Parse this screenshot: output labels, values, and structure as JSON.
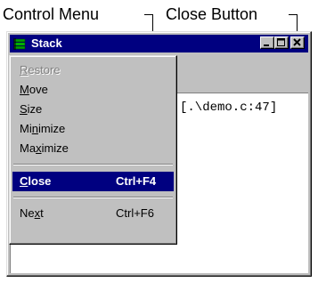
{
  "callouts": {
    "control_menu": "Control Menu",
    "close_button": "Close Button"
  },
  "window": {
    "title": "Stack",
    "content_text": "[.\\demo.c:47]"
  },
  "menu": {
    "items": [
      {
        "label": "Restore",
        "mnemonic": "R",
        "shortcut": "",
        "disabled": true
      },
      {
        "label": "Move",
        "mnemonic": "M",
        "shortcut": "",
        "disabled": false
      },
      {
        "label": "Size",
        "mnemonic": "S",
        "shortcut": "",
        "disabled": false
      },
      {
        "label": "Minimize",
        "mnemonic": "n",
        "shortcut": "",
        "disabled": false
      },
      {
        "label": "Maximize",
        "mnemonic": "x",
        "shortcut": "",
        "disabled": false
      },
      {
        "label": "Close",
        "mnemonic": "C",
        "shortcut": "Ctrl+F4",
        "selected": true
      },
      {
        "label": "Next",
        "mnemonic": "t",
        "shortcut": "Ctrl+F6",
        "disabled": false
      }
    ]
  },
  "colors": {
    "titlebar": "#000080",
    "menu_highlight": "#000080",
    "face": "#c0c0c0"
  }
}
